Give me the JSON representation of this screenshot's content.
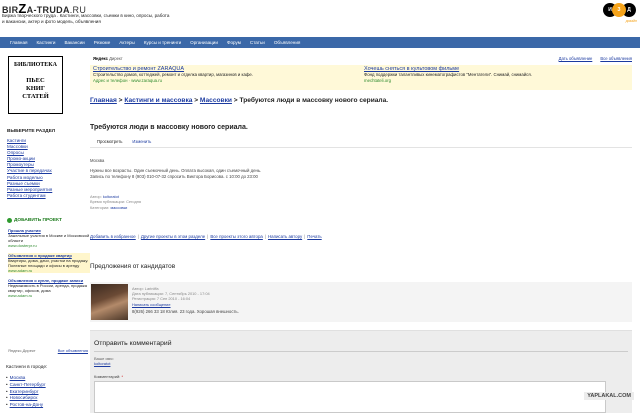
{
  "header": {
    "logo_left": "BIR",
    "logo_z": "Z",
    "logo_right": "A-TRUDA",
    "logo_ru": ".RU",
    "tagline": "Биржа творческого труда . Кастинги, массовки, съемки в кино, опросы, работа и вакансии, актер и фото модель, объявления",
    "badge_1": "И",
    "badge_2": "З",
    "badge_3": "Д",
    "badge_sub": "дизайн"
  },
  "nav": [
    "Главная",
    "Кастинги",
    "Вакансии",
    "Резюме",
    "Актеры",
    "Курсы и тренинги",
    "Организации",
    "Форум",
    "Статьи",
    "Объявления"
  ],
  "sidebar": {
    "library": [
      "БИБЛИОТЕКА",
      "ПЬЕС",
      "КНИГ",
      "СТАТЕЙ"
    ],
    "section_title": "ВЫБЕРИТЕ РАЗДЕЛ",
    "links": [
      "Кастинги",
      "Массовки",
      "Опросы",
      "Промо-акции",
      "Промоутеры",
      "Участие в передачах",
      "Работа моделью",
      "Разные съемки",
      "Разные мероприятия",
      "Работа студентам"
    ],
    "add_project": "ДОБАВИТЬ ПРОЕКТ",
    "ads": [
      {
        "title": "Прошла участия",
        "text": "Зажельные участия в Москве и Московской области",
        "url": "www.dosterpr.ru"
      },
      {
        "title": "Объявления о продаже квартир",
        "text": "Квартиры, дома, дачи, участки на продажу. Полезные площади и офисы в аренду",
        "url": "www.adam.ru"
      },
      {
        "title": "Объявления о купле, продаже записи",
        "text": "Недвижимость в России, аренда, продажа квартир, офисов, дома",
        "url": "www.adam.ru"
      }
    ],
    "yandex_direct": "Яндекс.Директ",
    "all_ads": "Все объявления",
    "castings_title": "Кастинги в городе:",
    "cities": [
      "Москва",
      "Санкт-Петербург",
      "Екатеринбург",
      "Новосибирск",
      "Ростов-на-Дону"
    ]
  },
  "topads": {
    "yandex": "Яндекс",
    "direct": "Директ",
    "give_ad": "Дать объявление",
    "all_ads": "Все объявления",
    "left": {
      "title": "Строительство и ремонт ZARAQUA",
      "text": "Строительство домов, коттеджей, ремонт и отделка квартир, магазинов и кафе.",
      "url": "Адрес и телефон · www.zaraqua.ru"
    },
    "right": {
      "title": "Хочешь сняться в культовом фильме",
      "text": "Фонд поддержки талантливых кинематографистов \"Ментатели\". Снимай, снимайся.",
      "url": "mechtateli.org"
    }
  },
  "content": {
    "breadcrumb": {
      "home": "Главная",
      "sep1": " > ",
      "cat": "Кастинги и массовка",
      "sep2": " > ",
      "sub": "Массовки",
      "sep3": " > ",
      "page": "Требуются люди в массовку нового сериала."
    },
    "title": "Требуются люди в массовку нового сериала.",
    "tab_view": "Просмотреть",
    "tab_edit": "Изменить",
    "city": "Москва",
    "text_line1": "Нужны все возрасты. Один съемочный день. Оплата высокая, один съемочный день.",
    "text_line2": "Запись по телефону 8 (903) 010-07-32 спросить Виктора Борисова. с 10:00 до 23:00",
    "meta_author_label": "Автор:",
    "meta_author": "koltoratot",
    "meta_date": "Время публикации: Сегодня",
    "meta_cat_label": "Категории:",
    "meta_cat": "массовки",
    "actions": [
      "Добавить в избранное",
      "Другие проекты в этом разделе",
      "Все проекты этого автора",
      "Написать автору",
      "Печать"
    ],
    "candidates_title": "Предложения от кандидатов",
    "cand": {
      "author": "Автор: Lariniffa",
      "date1": "Дата публикации: 7, Сентябрь 2010 - 17:04",
      "date2": "Регистрация: 7 Сен 2010 - 16:04",
      "send": "Написать сообщение",
      "text": "8(926) 266 33 18 Юлия. 23 года. Хорошая внешность."
    },
    "comment": {
      "title": "Отправить комментарий",
      "your_name": "Ваше имя:",
      "user": "koltoratot",
      "label": "Комментарий:",
      "star": "*"
    }
  },
  "watermark": "YAPLAKAL.COM"
}
